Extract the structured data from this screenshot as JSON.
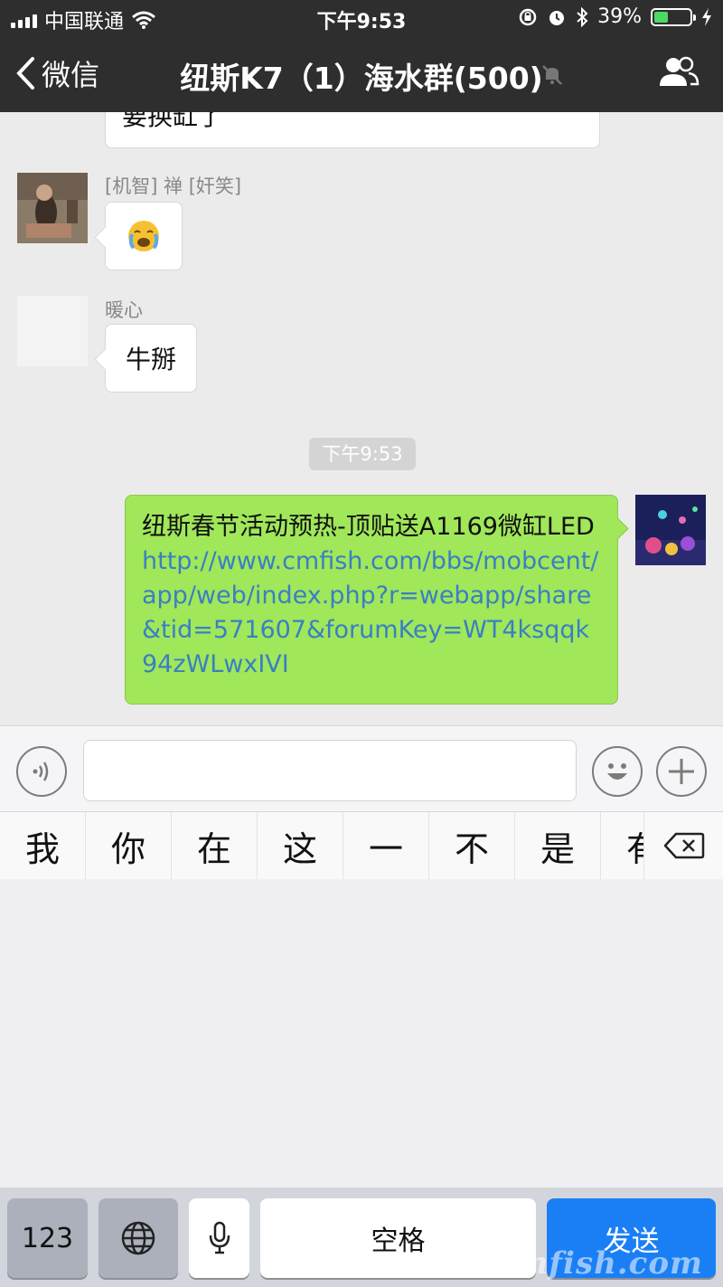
{
  "status_bar": {
    "carrier": "中国联通",
    "time": "下午9:53",
    "battery_percent": "39%",
    "battery_level": 0.39,
    "icons": [
      "signal-icon",
      "wifi-icon",
      "orientation-lock-icon",
      "alarm-icon",
      "bluetooth-icon",
      "battery-icon",
      "charging-icon"
    ]
  },
  "nav": {
    "back_label": "微信",
    "title": "纽斯K7（1）海水群(500)",
    "icons": [
      "chevron-left-icon",
      "mute-bell-icon",
      "group-members-icon"
    ]
  },
  "messages": {
    "partial_text": "要换缸了",
    "msg1": {
      "sender": "[机智] 禅 [奸笑]",
      "content": "😭"
    },
    "msg2": {
      "sender": "暖心",
      "content": "牛掰"
    },
    "timestamp": "下午9:53",
    "mine": {
      "text": "纽斯春节活动预热-顶贴送A1169微缸LED",
      "link": "http://www.cmfish.com/bbs/mobcent/app/web/index.php?r=webapp/share&tid=571607&forumKey=WT4ksqqk94zWLwxIVI"
    }
  },
  "input_bar": {
    "text_value": "",
    "icons": [
      "voice-icon",
      "emoji-icon",
      "plus-icon"
    ]
  },
  "candidates": [
    "我",
    "你",
    "在",
    "这",
    "一",
    "不",
    "是",
    "有"
  ],
  "keyboard": {
    "numbers_key": "123",
    "space_key": "空格",
    "send_key": "发送",
    "icons": [
      "globe-icon",
      "microphone-icon",
      "delete-icon"
    ]
  },
  "watermark": "cmfish.com",
  "colors": {
    "nav_bg": "#2e2e2e",
    "my_bubble": "#a0e75a",
    "link": "#3a7fc4",
    "send_key": "#1a7ff5",
    "battery": "#4cd964"
  }
}
